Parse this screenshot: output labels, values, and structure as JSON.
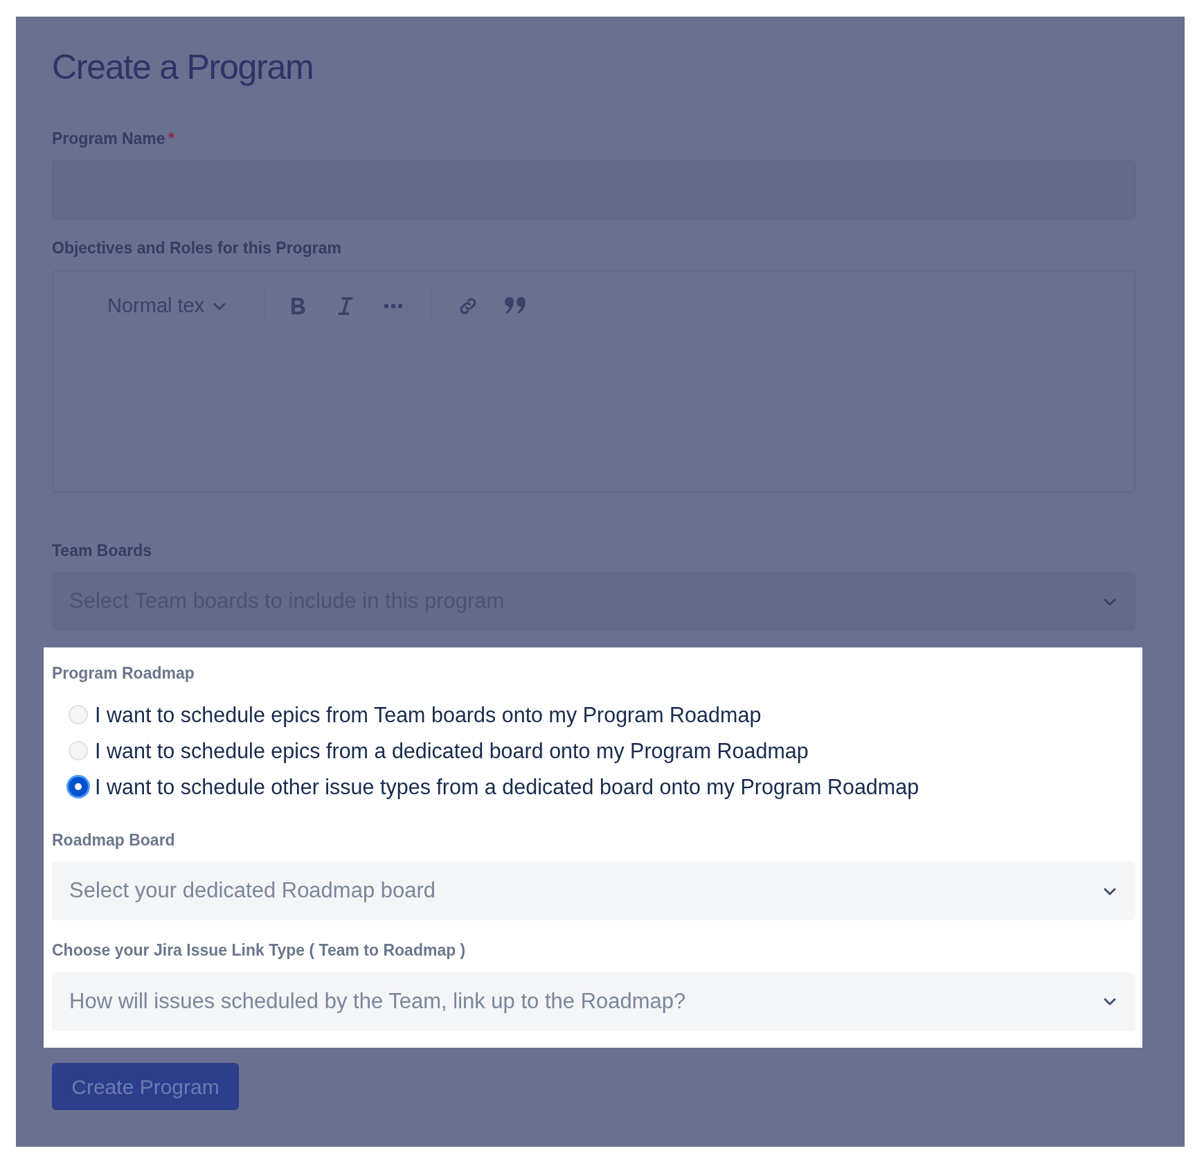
{
  "title": "Create a Program",
  "program_name": {
    "label": "Program Name",
    "required_mark": "*"
  },
  "objectives": {
    "label": "Objectives and Roles for this Program",
    "toolbar": {
      "text_style": "Normal tex"
    }
  },
  "team_boards": {
    "label": "Team Boards",
    "placeholder": "Select Team boards to include in this program"
  },
  "program_roadmap": {
    "label": "Program Roadmap",
    "options": [
      {
        "label": "I want to schedule epics from Team boards onto my Program Roadmap",
        "selected": false
      },
      {
        "label": "I want to schedule epics from a dedicated board onto my Program Roadmap",
        "selected": false
      },
      {
        "label": "I want to schedule other issue types from a dedicated board onto my Program Roadmap",
        "selected": true
      }
    ]
  },
  "roadmap_board": {
    "label": "Roadmap Board",
    "placeholder": "Select your dedicated Roadmap board"
  },
  "link_type": {
    "label": "Choose your Jira Issue Link Type ( Team to Roadmap )",
    "placeholder": "How will issues scheduled by the Team, link up to the Roadmap?"
  },
  "submit_button": "Create Program"
}
